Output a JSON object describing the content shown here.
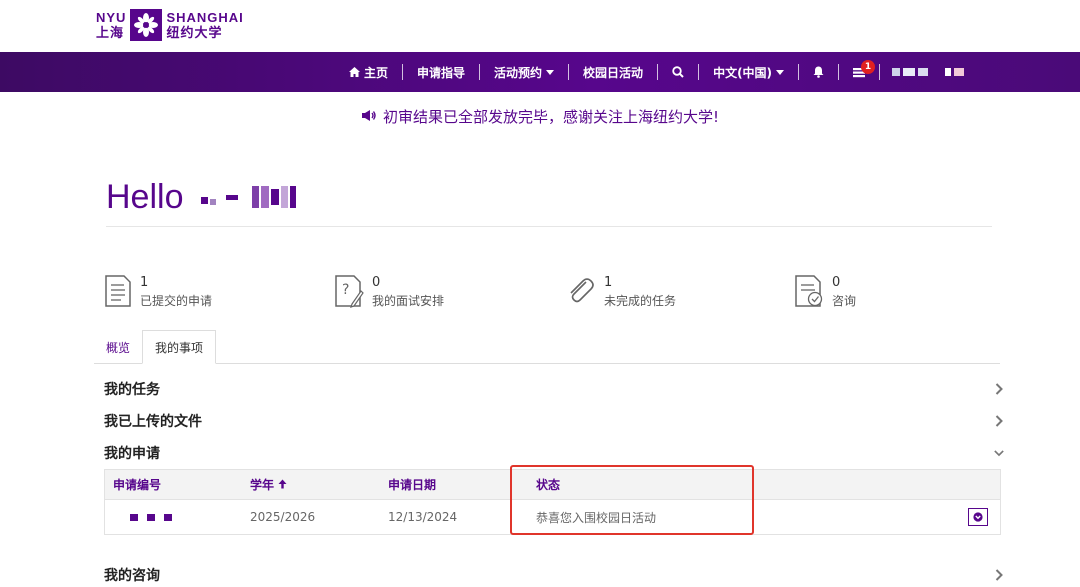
{
  "logo": {
    "left_top": "NYU",
    "left_bottom": "上海",
    "right_top": "SHANGHAI",
    "right_bottom": "纽约大学"
  },
  "nav": {
    "home": "主页",
    "guide": "申请指导",
    "booking": "活动预约",
    "campus_day": "校园日活动",
    "language": "中文(中国)",
    "notification_count": "1"
  },
  "announcement": "初审结果已全部发放完毕，感谢关注上海纽约大学!",
  "greeting": "Hello",
  "stats": [
    {
      "value": "1",
      "label": "已提交的申请"
    },
    {
      "value": "0",
      "label": "我的面试安排"
    },
    {
      "value": "1",
      "label": "未完成的任务"
    },
    {
      "value": "0",
      "label": "咨询"
    }
  ],
  "tabs": {
    "overview": "概览",
    "my_items": "我的事项"
  },
  "sections": {
    "tasks": "我的任务",
    "uploads": "我已上传的文件",
    "applications": "我的申请",
    "inquiries": "我的咨询"
  },
  "table": {
    "headers": {
      "id": "申请编号",
      "year": "学年",
      "date": "申请日期",
      "status": "状态"
    },
    "row": {
      "year": "2025/2026",
      "date": "12/13/2024",
      "status": "恭喜您入围校园日活动"
    }
  },
  "colors": {
    "brand": "#57068c",
    "highlight": "#e0352b",
    "badge": "#e02020"
  }
}
